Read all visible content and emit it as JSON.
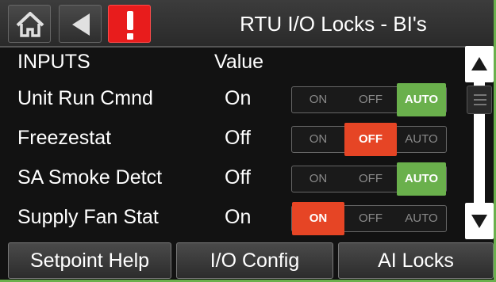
{
  "header": {
    "title": "RTU I/O Locks - BI's",
    "home_icon": "home-icon",
    "back_icon": "back-arrow-icon",
    "alert_icon": "alarm-exclamation-icon",
    "alert_color": "#e81c1c"
  },
  "table": {
    "col_inputs": "INPUTS",
    "col_value": "Value"
  },
  "rows": [
    {
      "name": "Unit Run Cmnd",
      "value": "On",
      "on": "ON",
      "off": "OFF",
      "auto": "AUTO",
      "selected": "auto"
    },
    {
      "name": "Freezestat",
      "value": "Off",
      "on": "ON",
      "off": "OFF",
      "auto": "AUTO",
      "selected": "off"
    },
    {
      "name": "SA Smoke Detct",
      "value": "Off",
      "on": "ON",
      "off": "OFF",
      "auto": "AUTO",
      "selected": "auto"
    },
    {
      "name": "Supply Fan Stat",
      "value": "On",
      "on": "ON",
      "off": "OFF",
      "auto": "AUTO",
      "selected": "on"
    }
  ],
  "scrollbar": {
    "up_icon": "triangle-up-icon",
    "down_icon": "triangle-down-icon"
  },
  "footer": {
    "setpoint_help": "Setpoint Help",
    "io_config": "I/O Config",
    "ai_locks": "AI Locks"
  },
  "colors": {
    "auto_active": "#6ab04c",
    "on_off_active": "#e64525"
  }
}
